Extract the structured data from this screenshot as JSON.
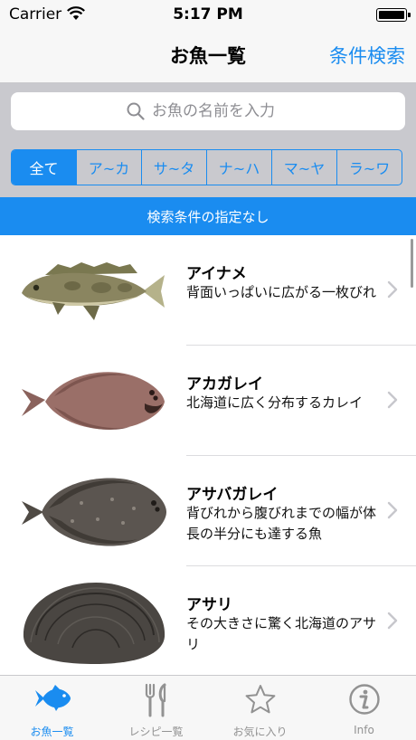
{
  "status_bar": {
    "carrier": "Carrier",
    "time": "5:17 PM"
  },
  "nav": {
    "title": "お魚一覧",
    "action": "条件検索"
  },
  "search": {
    "placeholder": "お魚の名前を入力"
  },
  "segments": [
    {
      "label": "全て",
      "selected": true
    },
    {
      "label": "ア~カ",
      "selected": false
    },
    {
      "label": "サ~タ",
      "selected": false
    },
    {
      "label": "ナ~ハ",
      "selected": false
    },
    {
      "label": "マ~ヤ",
      "selected": false
    },
    {
      "label": "ラ~ワ",
      "selected": false
    }
  ],
  "filter_banner": "検索条件の指定なし",
  "list": [
    {
      "name": "アイナメ",
      "desc": "背面いっぱいに広がる一枚びれ",
      "image": "greenling-fish-photo"
    },
    {
      "name": "アカガレイ",
      "desc": "北海道に広く分布するカレイ",
      "image": "flathead-flounder-photo"
    },
    {
      "name": "アサバガレイ",
      "desc": "背びれから腹びれまでの幅が体長の半分にも達する魚",
      "image": "dusky-sole-photo"
    },
    {
      "name": "アサリ",
      "desc": "その大きさに驚く北海道のアサリ",
      "image": "clam-shell-photo"
    }
  ],
  "tabs": [
    {
      "label": "お魚一覧",
      "icon": "fish-icon",
      "active": true
    },
    {
      "label": "レシピ一覧",
      "icon": "fork-knife-icon",
      "active": false
    },
    {
      "label": "お気に入り",
      "icon": "star-icon",
      "active": false
    },
    {
      "label": "Info",
      "icon": "info-icon",
      "active": false
    }
  ],
  "colors": {
    "accent": "#1a8cf0",
    "search_background": "#c9c9ce",
    "bar_background": "#f7f7f7"
  }
}
